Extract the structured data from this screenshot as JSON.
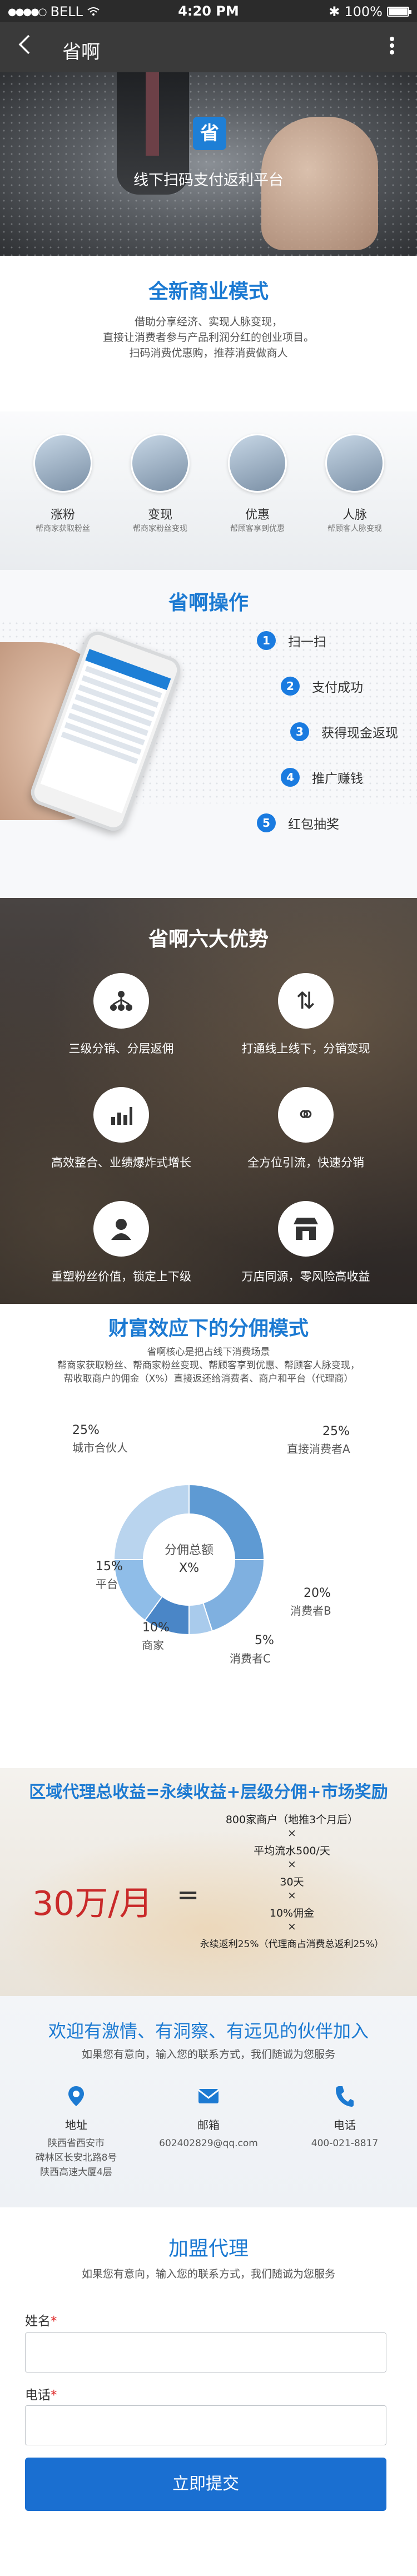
{
  "status_bar": {
    "carrier": "BELL",
    "time": "4:20 PM",
    "battery": "100%",
    "signal_dots": "●●●●○",
    "wifi_icon": "wifi-icon",
    "bluetooth_icon": "bluetooth-icon"
  },
  "nav": {
    "back_icon": "back-arrow-icon",
    "title": "省啊",
    "more_icon": "more-vertical-icon"
  },
  "hero": {
    "logo_text": "省",
    "slogan": "线下扫码支付返利平台"
  },
  "biz_model": {
    "title": "全新商业模式",
    "desc": [
      "借助分享经济、实现人脉变现，",
      "直接让消费者参与产品利润分红的创业项目。",
      "扫码消费优惠购，推荐消费做商人"
    ],
    "items": [
      {
        "name": "涨粉",
        "sub": "帮商家获取粉丝"
      },
      {
        "name": "变现",
        "sub": "帮商家粉丝变现"
      },
      {
        "name": "优惠",
        "sub": "帮顾客享到优惠"
      },
      {
        "name": "人脉",
        "sub": "帮顾客人脉变现"
      }
    ]
  },
  "operations": {
    "title": "省啊操作",
    "steps": [
      {
        "num": "1",
        "label": "扫一扫"
      },
      {
        "num": "2",
        "label": "支付成功"
      },
      {
        "num": "3",
        "label": "获得现金返现"
      },
      {
        "num": "4",
        "label": "推广赚钱"
      },
      {
        "num": "5",
        "label": "红包抽奖"
      }
    ]
  },
  "advantages": {
    "title": "省啊六大优势",
    "items": [
      {
        "label": "三级分销、分层返佣",
        "icon": "network-icon",
        "glyph": "⋔"
      },
      {
        "label": "打通线上线下，分销变现",
        "icon": "up-down-arrows-icon",
        "glyph": "⇅"
      },
      {
        "label": "高效整合、业绩爆炸式增长",
        "icon": "bar-chart-icon",
        "glyph": "▥"
      },
      {
        "label": "全方位引流，快速分销",
        "icon": "share-nodes-icon",
        "glyph": "⚭"
      },
      {
        "label": "重塑粉丝价值，锁定上下级",
        "icon": "user-icon",
        "glyph": "●"
      },
      {
        "label": "万店同源，零风险高收益",
        "icon": "store-icon",
        "glyph": "⌂"
      }
    ]
  },
  "distribution": {
    "title": "财富效应下的分佣模式",
    "desc": [
      "省啊核心是把占线下消费场景",
      "帮商家获取粉丝、帮商家粉丝变现、帮顾客享到优惠、帮顾客人脉变现，",
      "帮收取商户的佣金（X%）直接返还给消费者、商户和平台（代理商）"
    ],
    "center_label": "分佣总额",
    "center_value": "X%"
  },
  "chart_data": {
    "type": "pie",
    "title": "",
    "center_label": "分佣总额",
    "center_value": "X%",
    "slices": [
      {
        "label": "直接消费者A",
        "value": 25
      },
      {
        "label": "消费者B",
        "value": 20
      },
      {
        "label": "消费者C",
        "value": 5
      },
      {
        "label": "商家",
        "value": 10
      },
      {
        "label": "平台",
        "value": 15
      },
      {
        "label": "城市合伙人",
        "value": 25
      }
    ],
    "colors": [
      "#5e9ad3",
      "#7fb0e0",
      "#a9cbec",
      "#4a86c7",
      "#8fbde8",
      "#b9d4ee"
    ]
  },
  "region": {
    "title": "区域代理总收益=永续收益+层级分佣+市场奖励",
    "big": "30万/月",
    "eq": "=",
    "lines": [
      "800家商户（地推3个月后）",
      "×",
      "平均流水500/天",
      "×",
      "30天",
      "×",
      "10%佣金",
      "×",
      "永续返利25%（代理商占消费总返利25%）"
    ]
  },
  "partner": {
    "title": "欢迎有激情、有洞察、有远见的伙伴加入",
    "sub": "如果您有意向，输入您的联系方式，我们随诚为您服务",
    "contacts": [
      {
        "icon": "location-pin-icon",
        "glyph": "⚲",
        "label": "地址",
        "value": [
          "陕西省西安市",
          "碑林区长安北路8号",
          "陕西高速大厦4层"
        ]
      },
      {
        "icon": "mail-icon",
        "glyph": "✉",
        "label": "邮箱",
        "value": [
          "602402829@qq.com"
        ]
      },
      {
        "icon": "phone-icon",
        "glyph": "✆",
        "label": "电话",
        "value": [
          "400-021-8817"
        ]
      }
    ]
  },
  "join": {
    "title": "加盟代理",
    "sub": "如果您有意向，输入您的联系方式，我们随诚为您服务",
    "name_label": "姓名",
    "phone_label": "电话",
    "required_mark": "*",
    "name_value": "",
    "phone_value": "",
    "submit_label": "立即提交"
  }
}
